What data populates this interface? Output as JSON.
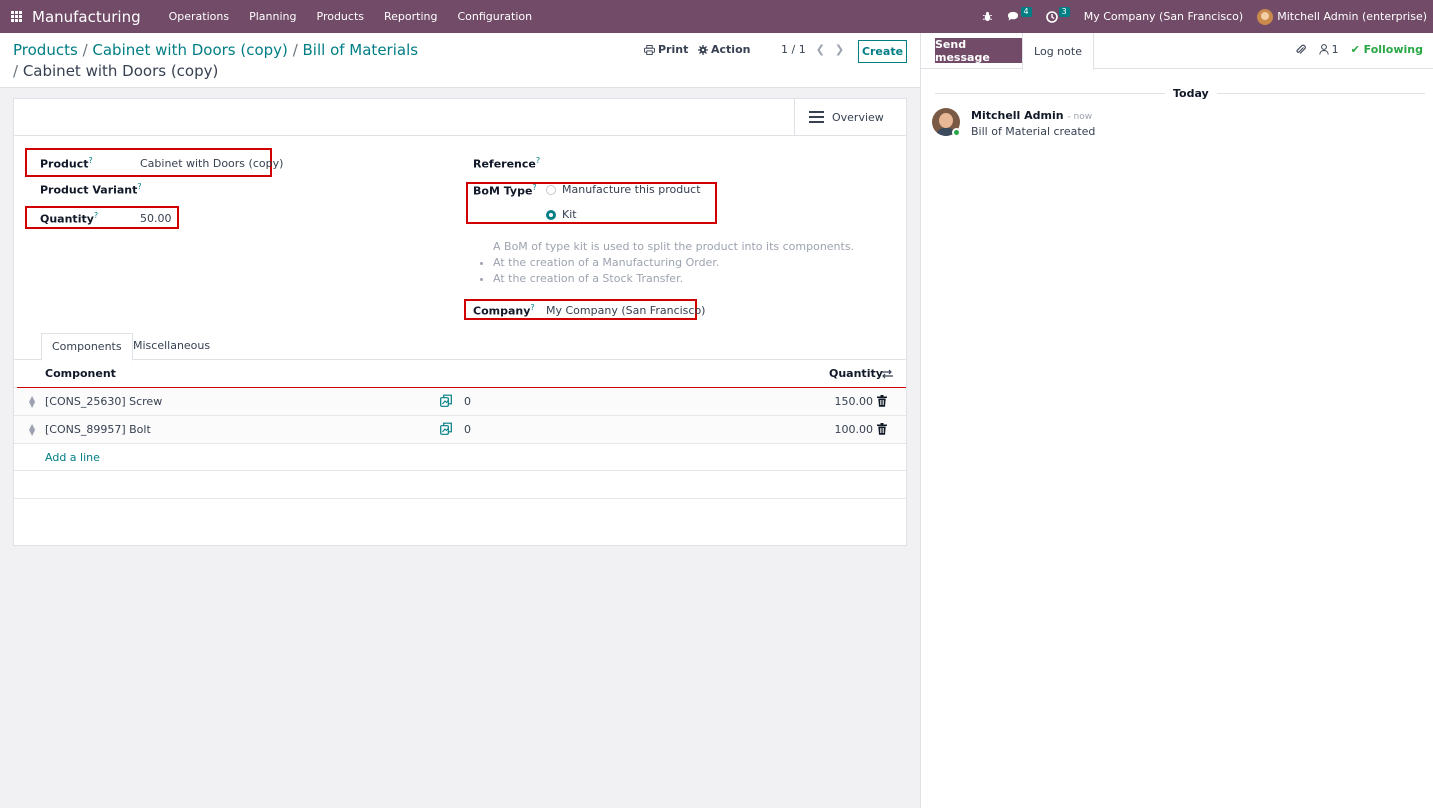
{
  "navbar": {
    "app_name": "Manufacturing",
    "menu": [
      "Operations",
      "Planning",
      "Products",
      "Reporting",
      "Configuration"
    ],
    "messages_count": "4",
    "activities_count": "3",
    "company": "My Company (San Francisco)",
    "user": "Mitchell Admin (enterprise)"
  },
  "breadcrumb": {
    "items": [
      "Products",
      "Cabinet with Doors (copy)",
      "Bill of Materials"
    ],
    "current": "Cabinet with Doors (copy)"
  },
  "controls": {
    "print_label": "Print",
    "action_label": "Action",
    "pager": "1 / 1",
    "create_label": "Create"
  },
  "form": {
    "overview_label": "Overview",
    "product_label": "Product",
    "product_value": "Cabinet with Doors (copy)",
    "variant_label": "Product Variant",
    "quantity_label": "Quantity",
    "quantity_value": "50.00",
    "reference_label": "Reference",
    "bom_type_label": "BoM Type",
    "bom_type_options": [
      "Manufacture this product",
      "Kit"
    ],
    "bom_type_selected": "Kit",
    "help_text": "A BoM of type kit is used to split the product into its components.",
    "help_items": [
      "At the creation of a Manufacturing Order.",
      "At the creation of a Stock Transfer."
    ],
    "company_label": "Company",
    "company_value": "My Company (San Francisco)",
    "help_mark": "?"
  },
  "tabs": [
    "Components",
    "Miscellaneous"
  ],
  "components": {
    "col_component": "Component",
    "col_quantity": "Quantity",
    "rows": [
      {
        "name": "[CONS_25630] Screw",
        "forecast": "0",
        "quantity": "150.00"
      },
      {
        "name": "[CONS_89957] Bolt",
        "forecast": "0",
        "quantity": "100.00"
      }
    ],
    "add_line": "Add a line"
  },
  "chatter": {
    "send_message": "Send message",
    "log_note": "Log note",
    "followers_count": "1",
    "following": "Following",
    "date_separator": "Today",
    "message": {
      "author": "Mitchell Admin",
      "time": "- now",
      "body": "Bill of Material created"
    }
  },
  "colors": {
    "brand": "#714b67",
    "accent": "#017e84",
    "highlight": "#d00000"
  }
}
